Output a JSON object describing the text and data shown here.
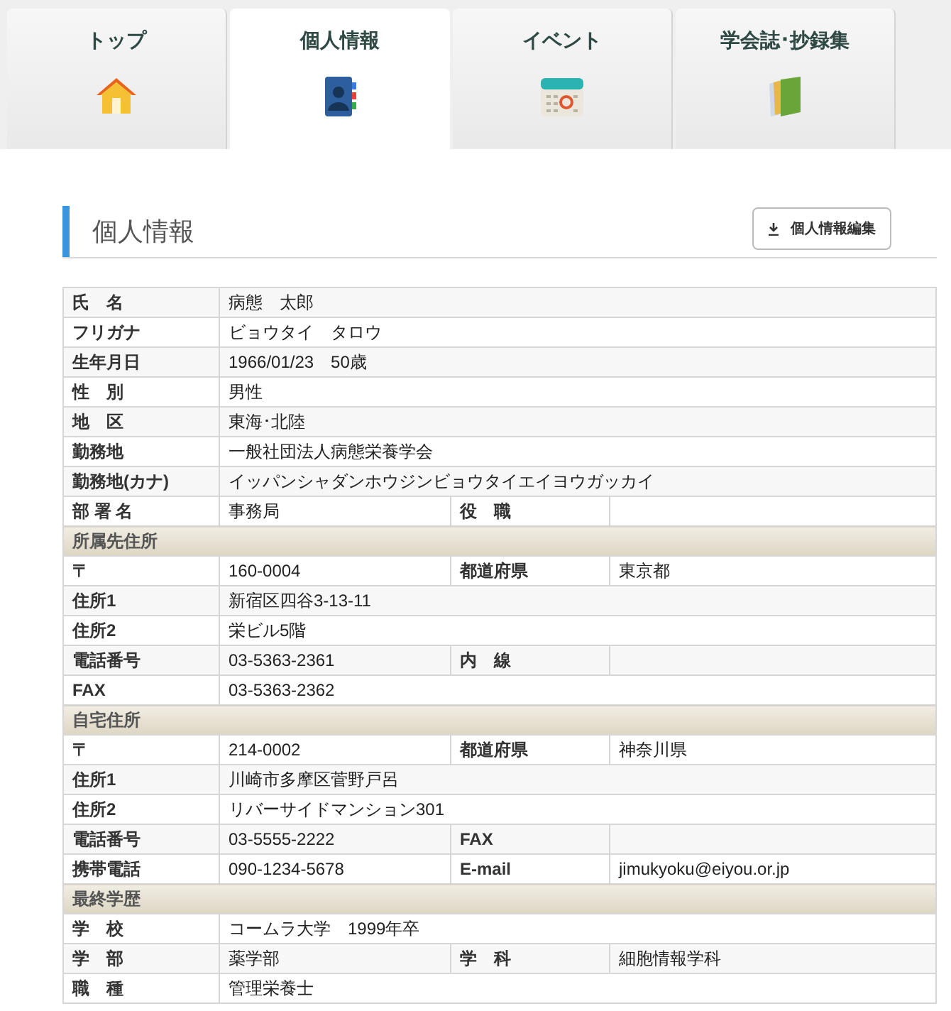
{
  "tabs": [
    {
      "label": "トップ",
      "kind": "house",
      "selected": false
    },
    {
      "label": "個人情報",
      "kind": "contacts",
      "selected": true
    },
    {
      "label": "イベント",
      "kind": "calendar",
      "selected": false
    },
    {
      "label": "学会誌･抄録集",
      "kind": "books",
      "selected": false
    }
  ],
  "heading": "個人情報",
  "edit_button": "個人情報編集",
  "rows": [
    {
      "kind": "field",
      "label": "氏　名",
      "value": "病態　太郎"
    },
    {
      "kind": "field",
      "label": "フリガナ",
      "value": "ビョウタイ　タロウ"
    },
    {
      "kind": "field",
      "label": "生年月日",
      "value": "1966/01/23　50歳"
    },
    {
      "kind": "field",
      "label": "性　別",
      "value": "男性"
    },
    {
      "kind": "field",
      "label": "地　区",
      "value": "東海･北陸"
    },
    {
      "kind": "field",
      "label": "勤務地",
      "value": "一般社団法人病態栄養学会"
    },
    {
      "kind": "field",
      "label": "勤務地(カナ)",
      "value": "イッパンシャダンホウジンビョウタイエイヨウガッカイ"
    },
    {
      "kind": "field",
      "label": "部 署 名",
      "value": "事務局",
      "label2": "役　職"
    },
    {
      "kind": "section",
      "label": "所属先住所"
    },
    {
      "kind": "field",
      "label": "〒",
      "value": "160-0004",
      "label2": "都道府県",
      "value2": "東京都"
    },
    {
      "kind": "field",
      "label": "住所1",
      "value": "新宿区四谷3-13-11"
    },
    {
      "kind": "field",
      "label": "住所2",
      "value": "栄ビル5階"
    },
    {
      "kind": "field",
      "label": "電話番号",
      "value": "03-5363-2361",
      "label2": "内　線"
    },
    {
      "kind": "field",
      "label": "FAX",
      "value": "03-5363-2362"
    },
    {
      "kind": "section",
      "label": "自宅住所"
    },
    {
      "kind": "field",
      "label": "〒",
      "value": "214-0002",
      "label2": "都道府県",
      "value2": "神奈川県"
    },
    {
      "kind": "field",
      "label": "住所1",
      "value": "川崎市多摩区菅野戸呂"
    },
    {
      "kind": "field",
      "label": "住所2",
      "value": "リバーサイドマンション301"
    },
    {
      "kind": "field",
      "label": "電話番号",
      "value": "03-5555-2222",
      "label2": "FAX"
    },
    {
      "kind": "field",
      "label": "携帯電話",
      "value": "090-1234-5678",
      "label2": "E-mail",
      "value2": "jimukyoku@eiyou.or.jp"
    },
    {
      "kind": "section",
      "label": "最終学歴"
    },
    {
      "kind": "field",
      "label": "学　校",
      "value": "コームラ大学　1999年卒"
    },
    {
      "kind": "field",
      "label": "学　部",
      "value": "薬学部",
      "label2": "学　科",
      "value2": "細胞情報学科"
    },
    {
      "kind": "field",
      "label": "職　種",
      "value": "管理栄養士"
    }
  ]
}
